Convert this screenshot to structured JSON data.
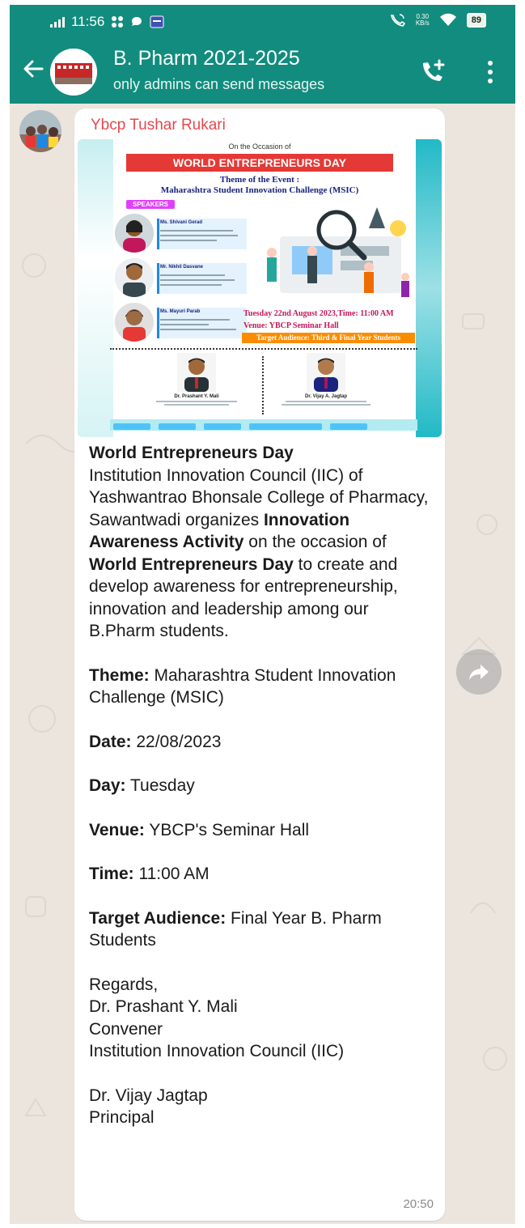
{
  "status_bar": {
    "time": "11:56",
    "net_speed_value": "0.30",
    "net_speed_unit": "KB/s",
    "battery": "89"
  },
  "header": {
    "group_name": "B. Pharm 2021-2025",
    "subtitle": "only admins can send messages",
    "icons": {
      "back": "arrow-left-icon",
      "call": "add-call-icon",
      "menu": "kebab-menu-icon"
    }
  },
  "message": {
    "sender": "Ybcp Tushar Rukari",
    "sender_color": "#e5484d",
    "time": "20:50",
    "poster": {
      "occasion": "On the Occasion of",
      "banner": "WORLD ENTREPRENEURS DAY",
      "theme_label": "Theme of the Event :",
      "theme_title": "Maharashtra Student Innovation Challenge (MSIC)",
      "speakers_label": "SPEAKERS",
      "speakers": [
        {
          "name": "Ms. Shivani Gerad"
        },
        {
          "name": "Mr. Nikhil Dasvane"
        },
        {
          "name": "Ms. Mayuri Parab"
        }
      ],
      "date_line": "Tuesday 22nd August 2023,Time: 11:00 AM",
      "venue_line": "Venue: YBCP Seminar Hall",
      "target_line": "Target Audience: Third & Final Year Students",
      "convener": "Dr. Prashant Y. Mali",
      "principal": "Dr. Vijay A. Jagtap"
    },
    "body": {
      "intro_title": "World Entrepreneurs Day",
      "intro_1": "Institution Innovation Council (IIC) of Yashwantrao Bhonsale College of Pharmacy, Sawantwadi organizes ",
      "intro_bold_1": "Innovation Awareness Activity",
      "intro_2": " on the occasion of ",
      "intro_bold_2": "World Entrepreneurs Day",
      "intro_3": " to create and develop awareness for entrepreneurship, innovation and leadership among our B.Pharm students.",
      "theme_label": "Theme:",
      "theme_value": " Maharashtra Student Innovation Challenge (MSIC)",
      "date_label": "Date:",
      "date_value": " 22/08/2023",
      "day_label": "Day:",
      "day_value": " Tuesday",
      "venue_label": "Venue:",
      "venue_value": " YBCP's Seminar Hall",
      "time_label": "Time:",
      "time_value": " 11:00 AM",
      "audience_label": "Target Audience:",
      "audience_value": " Final Year B. Pharm Students",
      "regards": "Regards,",
      "sig1_name": "Dr. Prashant Y. Mali",
      "sig1_role": "Convener",
      "sig1_org": "Institution Innovation Council (IIC)",
      "sig2_name": "Dr. Vijay Jagtap",
      "sig2_role": "Principal"
    }
  },
  "forward_icon": "forward-arrow-icon",
  "colors": {
    "header": "#128c7e",
    "chat_bg": "#ece5dd",
    "banner_red": "#e53935"
  }
}
